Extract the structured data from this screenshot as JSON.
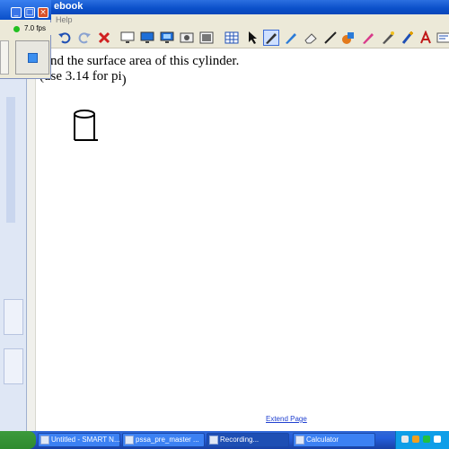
{
  "window": {
    "title": "ebook",
    "menu_hint": "Help"
  },
  "recorder": {
    "fps": "7.0 fps"
  },
  "toolbar": {
    "tools": [
      "undo-icon",
      "redo-icon",
      "delete-icon",
      "screen-shade-icon",
      "display-icon",
      "screen-capture-icon",
      "camera-icon",
      "gallery-icon",
      "table-icon",
      "select-arrow-icon",
      "pen-icon",
      "creative-pen-icon",
      "eraser-icon",
      "line-icon",
      "shapes-icon",
      "fill-icon",
      "magic-pen-icon",
      "magic-wand-icon",
      "text-icon",
      "properties-icon"
    ]
  },
  "canvas": {
    "line1": "nd the surface area of this cylinder.",
    "line2": "(use 3.14 for pi",
    "line2_suffix": ")",
    "extend_page": "Extend Page"
  },
  "taskbar": {
    "tasks": [
      "Untitled - SMART N...",
      "pssa_pre_master ...",
      "Recording...",
      "Calculator"
    ]
  },
  "colors": {
    "titlebar": "#0a4fc9",
    "taskbar": "#245edb",
    "link": "#2040d0"
  }
}
